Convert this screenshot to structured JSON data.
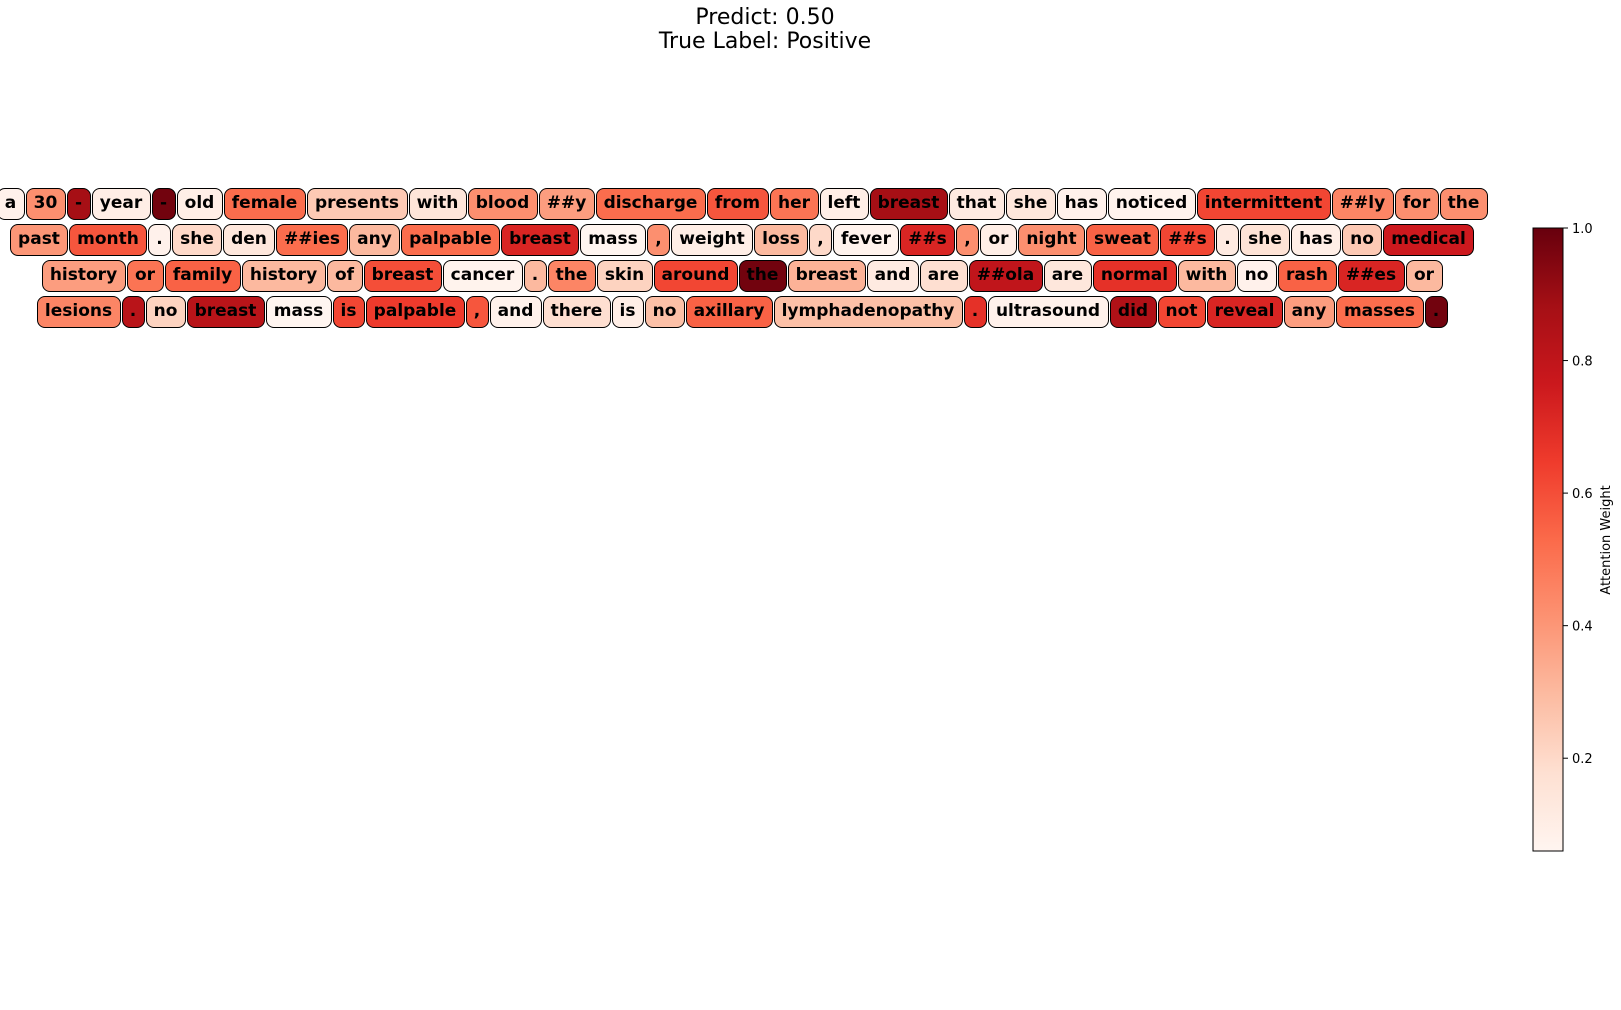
{
  "title": {
    "line1": "Predict: 0.50",
    "line2": "True Label: Positive"
  },
  "chart_data": {
    "type": "heatmap",
    "rows": [
      [
        {
          "token": "a",
          "weight": 0.08
        },
        {
          "token": "30",
          "weight": 0.42
        },
        {
          "token": "-",
          "weight": 0.88
        },
        {
          "token": "year",
          "weight": 0.1
        },
        {
          "token": "-",
          "weight": 0.98
        },
        {
          "token": "old",
          "weight": 0.1
        },
        {
          "token": "female",
          "weight": 0.52
        },
        {
          "token": "presents",
          "weight": 0.25
        },
        {
          "token": "with",
          "weight": 0.15
        },
        {
          "token": "blood",
          "weight": 0.42
        },
        {
          "token": "##y",
          "weight": 0.38
        },
        {
          "token": "discharge",
          "weight": 0.52
        },
        {
          "token": "from",
          "weight": 0.58
        },
        {
          "token": "her",
          "weight": 0.5
        },
        {
          "token": "left",
          "weight": 0.1
        },
        {
          "token": "breast",
          "weight": 0.88
        },
        {
          "token": "that",
          "weight": 0.12
        },
        {
          "token": "she",
          "weight": 0.14
        },
        {
          "token": "has",
          "weight": 0.08
        },
        {
          "token": "noticed",
          "weight": 0.07
        },
        {
          "token": "intermittent",
          "weight": 0.62
        },
        {
          "token": "##ly",
          "weight": 0.45
        },
        {
          "token": "for",
          "weight": 0.42
        },
        {
          "token": "the",
          "weight": 0.42
        }
      ],
      [
        {
          "token": "past",
          "weight": 0.4
        },
        {
          "token": "month",
          "weight": 0.58
        },
        {
          "token": ".",
          "weight": 0.08
        },
        {
          "token": "she",
          "weight": 0.2
        },
        {
          "token": "den",
          "weight": 0.14
        },
        {
          "token": "##ies",
          "weight": 0.52
        },
        {
          "token": "any",
          "weight": 0.3
        },
        {
          "token": "palpable",
          "weight": 0.52
        },
        {
          "token": "breast",
          "weight": 0.72
        },
        {
          "token": "mass",
          "weight": 0.05
        },
        {
          "token": ",",
          "weight": 0.42
        },
        {
          "token": "weight",
          "weight": 0.1
        },
        {
          "token": "loss",
          "weight": 0.3
        },
        {
          "token": ",",
          "weight": 0.2
        },
        {
          "token": "fever",
          "weight": 0.07
        },
        {
          "token": "##s",
          "weight": 0.72
        },
        {
          "token": ",",
          "weight": 0.42
        },
        {
          "token": "or",
          "weight": 0.1
        },
        {
          "token": "night",
          "weight": 0.42
        },
        {
          "token": "sweat",
          "weight": 0.55
        },
        {
          "token": "##s",
          "weight": 0.62
        },
        {
          "token": ".",
          "weight": 0.12
        },
        {
          "token": "she",
          "weight": 0.16
        },
        {
          "token": "has",
          "weight": 0.1
        },
        {
          "token": "no",
          "weight": 0.25
        },
        {
          "token": "medical",
          "weight": 0.76
        }
      ],
      [
        {
          "token": "history",
          "weight": 0.38
        },
        {
          "token": "or",
          "weight": 0.5
        },
        {
          "token": "family",
          "weight": 0.55
        },
        {
          "token": "history",
          "weight": 0.3
        },
        {
          "token": "of",
          "weight": 0.3
        },
        {
          "token": "breast",
          "weight": 0.6
        },
        {
          "token": "cancer",
          "weight": 0.07
        },
        {
          "token": ".",
          "weight": 0.3
        },
        {
          "token": "the",
          "weight": 0.45
        },
        {
          "token": "skin",
          "weight": 0.22
        },
        {
          "token": "around",
          "weight": 0.62
        },
        {
          "token": "the",
          "weight": 0.98
        },
        {
          "token": "breast",
          "weight": 0.32
        },
        {
          "token": "and",
          "weight": 0.12
        },
        {
          "token": "are",
          "weight": 0.18
        },
        {
          "token": "##ola",
          "weight": 0.8
        },
        {
          "token": "are",
          "weight": 0.14
        },
        {
          "token": "normal",
          "weight": 0.68
        },
        {
          "token": "with",
          "weight": 0.3
        },
        {
          "token": "no",
          "weight": 0.08
        },
        {
          "token": "rash",
          "weight": 0.55
        },
        {
          "token": "##es",
          "weight": 0.72
        },
        {
          "token": "or",
          "weight": 0.3
        }
      ],
      [
        {
          "token": "lesions",
          "weight": 0.45
        },
        {
          "token": ".",
          "weight": 0.82
        },
        {
          "token": "no",
          "weight": 0.22
        },
        {
          "token": "breast",
          "weight": 0.82
        },
        {
          "token": "mass",
          "weight": 0.05
        },
        {
          "token": "is",
          "weight": 0.62
        },
        {
          "token": "palpable",
          "weight": 0.65
        },
        {
          "token": ",",
          "weight": 0.58
        },
        {
          "token": "and",
          "weight": 0.08
        },
        {
          "token": "there",
          "weight": 0.18
        },
        {
          "token": "is",
          "weight": 0.1
        },
        {
          "token": "no",
          "weight": 0.28
        },
        {
          "token": "axillary",
          "weight": 0.55
        },
        {
          "token": "lymphadenopathy",
          "weight": 0.28
        },
        {
          "token": ".",
          "weight": 0.68
        },
        {
          "token": "ultrasound",
          "weight": 0.08
        },
        {
          "token": "did",
          "weight": 0.85
        },
        {
          "token": "not",
          "weight": 0.62
        },
        {
          "token": "reveal",
          "weight": 0.72
        },
        {
          "token": "any",
          "weight": 0.38
        },
        {
          "token": "masses",
          "weight": 0.52
        },
        {
          "token": ".",
          "weight": 0.98
        }
      ]
    ],
    "colormap": [
      "#fff5f0",
      "#fee0d2",
      "#fcbba1",
      "#fc9272",
      "#fb6a4a",
      "#ef3b2c",
      "#cb181d",
      "#a50f15",
      "#67000d"
    ],
    "colorbar": {
      "label": "Attention Weight",
      "range": [
        0.06,
        1.0
      ],
      "ticks": [
        "0.2",
        "0.4",
        "0.6",
        "0.8",
        "1.0"
      ]
    }
  }
}
